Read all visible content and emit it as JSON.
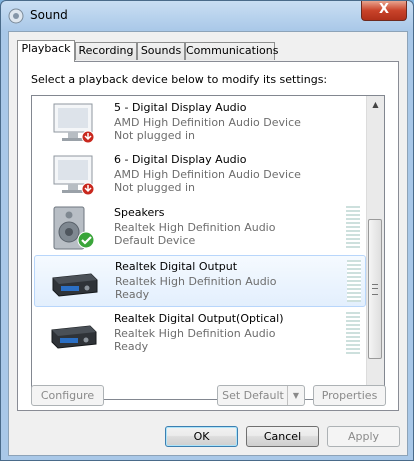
{
  "window": {
    "title": "Sound",
    "close_glyph": "X"
  },
  "tabs": [
    {
      "label": "Playback",
      "active": true
    },
    {
      "label": "Recording",
      "active": false
    },
    {
      "label": "Sounds",
      "active": false
    },
    {
      "label": "Communications",
      "active": false
    }
  ],
  "instructions": "Select a playback device below to modify its settings:",
  "devices": [
    {
      "name": "5 - Digital Display Audio",
      "driver": "AMD High Definition Audio Device",
      "status": "Not plugged in",
      "icon": "monitor-icon",
      "badge": "unplugged-badge-icon"
    },
    {
      "name": "6 - Digital Display Audio",
      "driver": "AMD High Definition Audio Device",
      "status": "Not plugged in",
      "icon": "monitor-icon",
      "badge": "unplugged-badge-icon"
    },
    {
      "name": "Speakers",
      "driver": "Realtek High Definition Audio",
      "status": "Default Device",
      "icon": "speaker-icon",
      "badge": "default-check-icon"
    },
    {
      "name": "Realtek Digital Output",
      "driver": "Realtek High Definition Audio",
      "status": "Ready",
      "icon": "receiver-icon",
      "selected": true
    },
    {
      "name": "Realtek Digital Output(Optical)",
      "driver": "Realtek High Definition Audio",
      "status": "Ready",
      "icon": "receiver-icon"
    }
  ],
  "buttons": {
    "configure": "Configure",
    "set_default": "Set Default",
    "properties": "Properties",
    "ok": "OK",
    "cancel": "Cancel",
    "apply": "Apply"
  },
  "colors": {
    "selection": "#e3effd",
    "check_green": "#3aa53a",
    "badge_red": "#c8281e"
  }
}
